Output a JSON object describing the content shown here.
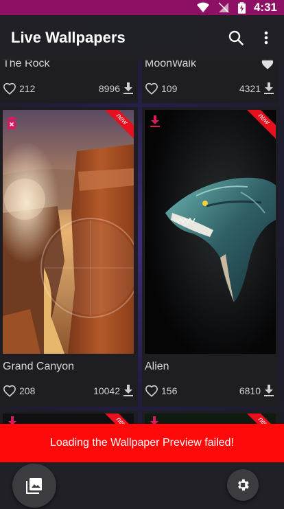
{
  "status_bar": {
    "time": "4:31",
    "background": "#8e1065"
  },
  "app_bar": {
    "title": "Live Wallpapers",
    "search_icon": "search-icon",
    "menu_icon": "more-vert-icon"
  },
  "wallpapers": [
    {
      "name": "The Rock",
      "likes": "212",
      "downloads": "8996"
    },
    {
      "name": "MoonWalk",
      "likes": "109",
      "downloads": "4321"
    },
    {
      "name": "Grand Canyon",
      "likes": "208",
      "downloads": "10042",
      "badge": "new",
      "action_icon": "delete-icon"
    },
    {
      "name": "Alien",
      "likes": "156",
      "downloads": "6810",
      "badge": "new",
      "action_icon": "download-icon"
    },
    {
      "badge": "new",
      "action_icon": "download-icon"
    },
    {
      "badge": "new",
      "action_icon": "download-icon"
    }
  ],
  "toast": {
    "message": "Loading the Wallpaper Preview failed!",
    "background": "#ff0a0a"
  },
  "bottom_bar": {
    "left_button_icon": "gallery-icon",
    "right_button_icon": "settings-gear-icon"
  },
  "colors": {
    "accent": "#d81b60",
    "ribbon": "#e8101f"
  }
}
